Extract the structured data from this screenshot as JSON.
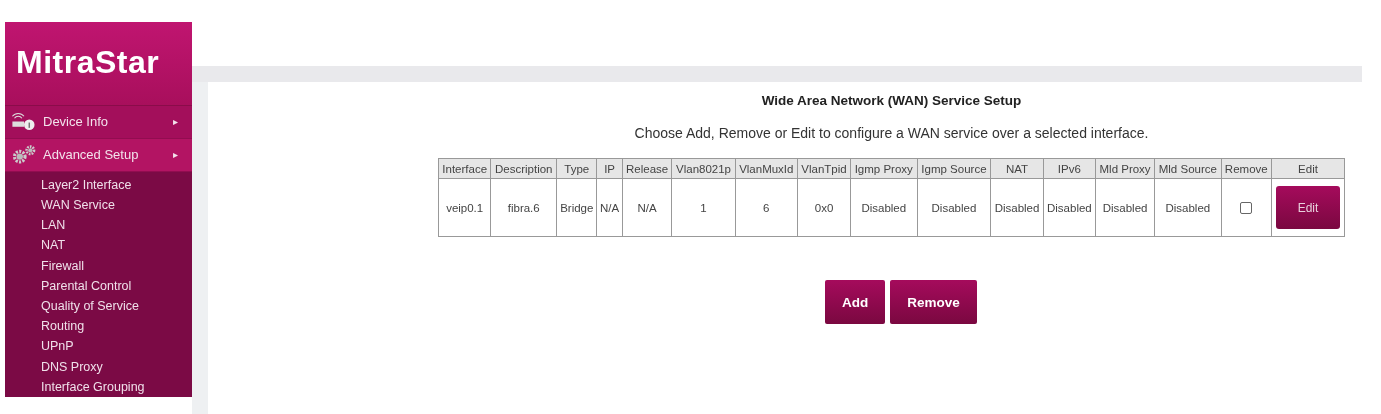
{
  "logo": "MitraStar",
  "menu": [
    {
      "label": "Device Info",
      "kind": "device",
      "arrow": "▸",
      "selected": false
    },
    {
      "label": "Advanced Setup",
      "kind": "settings",
      "arrow": "▸",
      "selected": true
    }
  ],
  "submenu": [
    {
      "label": "Layer2 Interface"
    },
    {
      "label": "WAN Service"
    },
    {
      "label": "LAN"
    },
    {
      "label": "NAT"
    },
    {
      "label": "Firewall"
    },
    {
      "label": "Parental Control"
    },
    {
      "label": "Quality of Service"
    },
    {
      "label": "Routing"
    },
    {
      "label": "UPnP"
    },
    {
      "label": "DNS Proxy"
    },
    {
      "label": "Interface Grouping"
    }
  ],
  "title": "Wide Area Network (WAN) Service Setup",
  "intro": "Choose Add, Remove or Edit to configure a WAN service over a selected interface.",
  "table": {
    "columns": [
      "Interface",
      "Description",
      "Type",
      "IP",
      "Release",
      "Vlan8021p",
      "VlanMuxId",
      "VlanTpid",
      "Igmp Proxy",
      "Igmp Source",
      "NAT",
      "IPv6",
      "Mld Proxy",
      "Mld Source",
      "Remove",
      "Edit"
    ],
    "rows": [
      {
        "cells": [
          "veip0.1",
          "fibra.6",
          "Bridge",
          "N/A",
          "N/A",
          "1",
          "6",
          "0x0",
          "Disabled",
          "Disabled",
          "Disabled",
          "Disabled",
          "Disabled",
          "Disabled"
        ],
        "remove_checked": false,
        "edit_label": "Edit"
      }
    ]
  },
  "buttons": [
    "Add",
    "Remove"
  ]
}
